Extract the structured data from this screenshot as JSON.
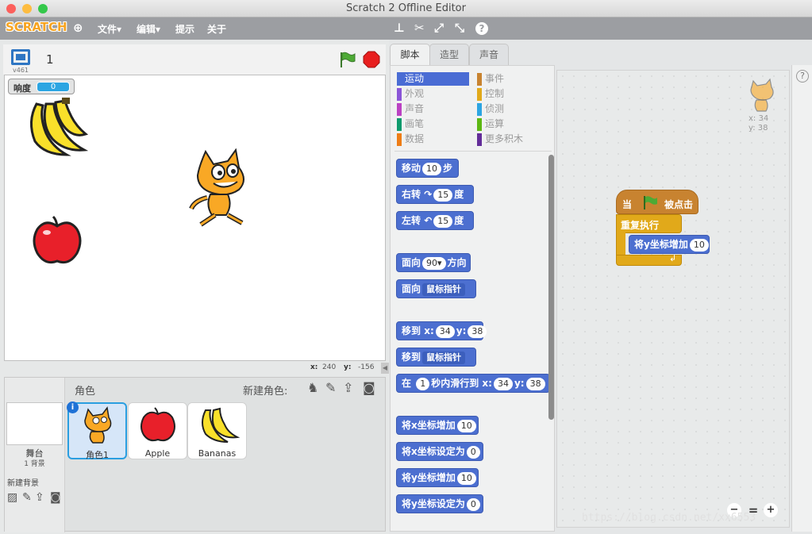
{
  "window": {
    "title": "Scratch 2 Offline Editor"
  },
  "menubar": {
    "logo": "SCRATCH",
    "items": [
      {
        "label": "文件▾"
      },
      {
        "label": "编辑▾"
      },
      {
        "label": "提示"
      },
      {
        "label": "关于"
      }
    ]
  },
  "stage_header": {
    "version": "v461",
    "sprite_count": "1"
  },
  "stage": {
    "monitor_label": "响度",
    "monitor_value": "0",
    "mouse_x_label": "x:",
    "mouse_x": "240",
    "mouse_y_label": "y:",
    "mouse_y": "-156"
  },
  "sprites_panel": {
    "title": "角色",
    "new_sprite_label": "新建角色:",
    "stage_label": "舞台",
    "stage_sub": "1 背景",
    "new_backdrop_label": "新建背景",
    "sprites": [
      {
        "name": "角色1",
        "selected": true
      },
      {
        "name": "Apple"
      },
      {
        "name": "Bananas"
      }
    ]
  },
  "tabs": [
    {
      "label": "脚本",
      "active": true
    },
    {
      "label": "造型"
    },
    {
      "label": "声音"
    }
  ],
  "categories": {
    "left": [
      {
        "label": "运动",
        "color": "#4a6cd4",
        "active": true
      },
      {
        "label": "外观",
        "color": "#8a55d7"
      },
      {
        "label": "声音",
        "color": "#bb42c3"
      },
      {
        "label": "画笔",
        "color": "#0e9a6c"
      },
      {
        "label": "数据",
        "color": "#ee7d16"
      }
    ],
    "right": [
      {
        "label": "事件",
        "color": "#c88330"
      },
      {
        "label": "控制",
        "color": "#e1a91a"
      },
      {
        "label": "侦测",
        "color": "#2ca5e2"
      },
      {
        "label": "运算",
        "color": "#5cb712"
      },
      {
        "label": "更多积木",
        "color": "#632d99"
      }
    ]
  },
  "blocks": {
    "move": {
      "a": "移动",
      "v": "10",
      "b": "步"
    },
    "turn_right": {
      "a": "右转",
      "icon": "↷",
      "v": "15",
      "b": "度"
    },
    "turn_left": {
      "a": "左转",
      "icon": "↶",
      "v": "15",
      "b": "度"
    },
    "point_dir": {
      "a": "面向",
      "v": "90▾",
      "b": "方向"
    },
    "point_towards": {
      "a": "面向",
      "v": "鼠标指针"
    },
    "goto_xy": {
      "a": "移到",
      "x": "x:",
      "xv": "34",
      "y": "y:",
      "yv": "38"
    },
    "goto": {
      "a": "移到",
      "v": "鼠标指针"
    },
    "glide": {
      "a": "在",
      "v": "1",
      "b": "秒内滑行到",
      "x": "x:",
      "xv": "34",
      "y": "y:",
      "yv": "38"
    },
    "change_x": {
      "a": "将x坐标增加",
      "v": "10"
    },
    "set_x": {
      "a": "将x坐标设定为",
      "v": "0"
    },
    "change_y": {
      "a": "将y坐标增加",
      "v": "10"
    },
    "set_y": {
      "a": "将y坐标设定为",
      "v": "0"
    }
  },
  "script": {
    "hat_a": "当",
    "hat_b": "被点击",
    "forever": "重复执行",
    "inner": "将y坐标增加",
    "inner_v": "10",
    "sprite_x": "x: 34",
    "sprite_y": "y: 38"
  },
  "watermark": "https://blog.csdn.net/xx6553"
}
